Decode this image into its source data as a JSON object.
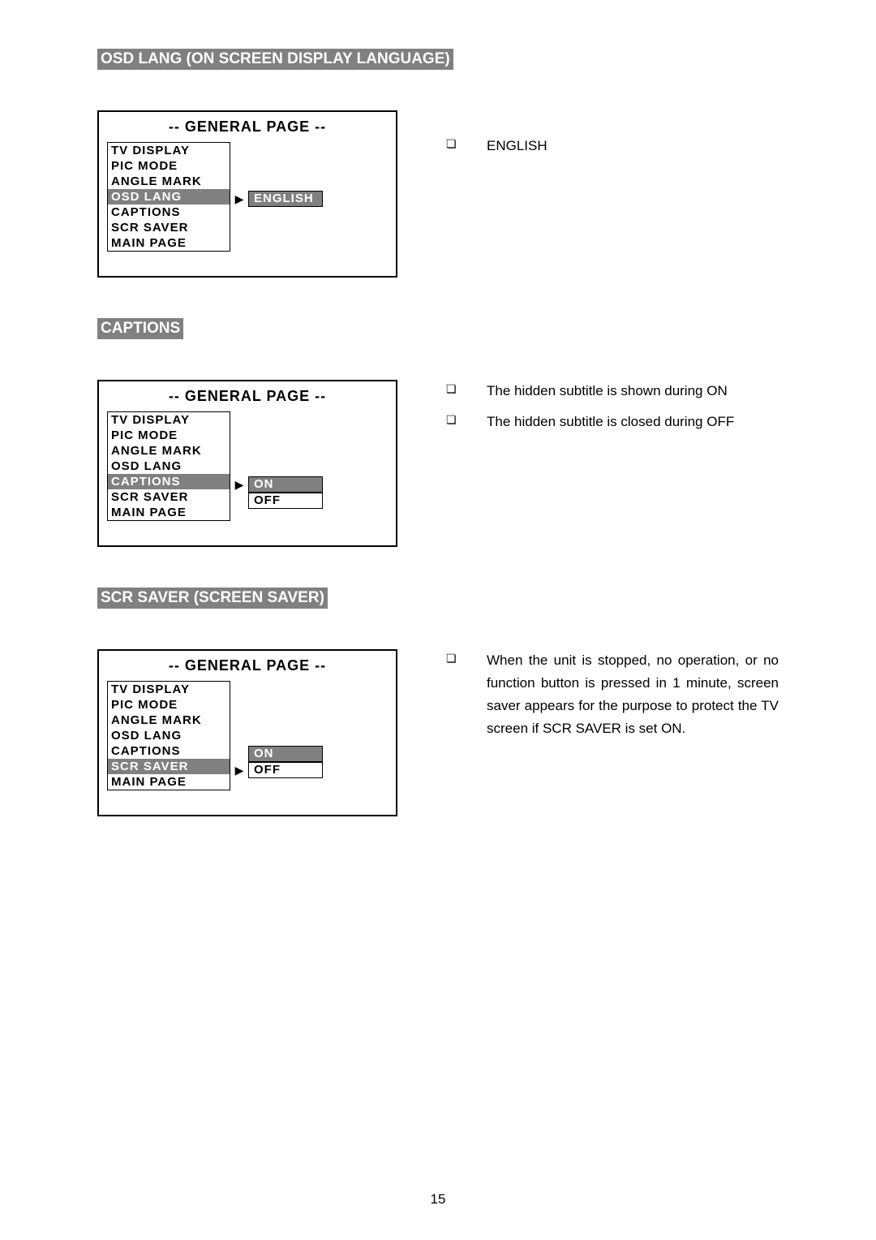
{
  "headers": {
    "osd_lang": "OSD LANG (ON SCREEN DISPLAY LANGUAGE)",
    "captions": "CAPTIONS",
    "scr_saver": "SCR SAVER (SCREEN SAVER)"
  },
  "osd_title": "-- GENERAL PAGE --",
  "menu_items": {
    "tv_display": "TV DISPLAY",
    "pic_mode": "PIC MODE",
    "angle_mark": "ANGLE MARK",
    "osd_lang": "OSD LANG",
    "captions": "CAPTIONS",
    "scr_saver": "SCR SAVER",
    "main_page": "MAIN PAGE"
  },
  "options": {
    "english": "ENGLISH",
    "on": "ON",
    "off": "OFF"
  },
  "arrow": "▶",
  "bullet": "❏",
  "desc": {
    "english": "ENGLISH",
    "captions_on": "The hidden subtitle is shown during ON",
    "captions_off": "The hidden subtitle is closed during OFF",
    "scr_saver": "When the unit is stopped, no operation, or no function button is pressed in 1 minute, screen saver appears for the purpose to protect the TV screen if SCR SAVER is set ON."
  },
  "page_number": "15"
}
